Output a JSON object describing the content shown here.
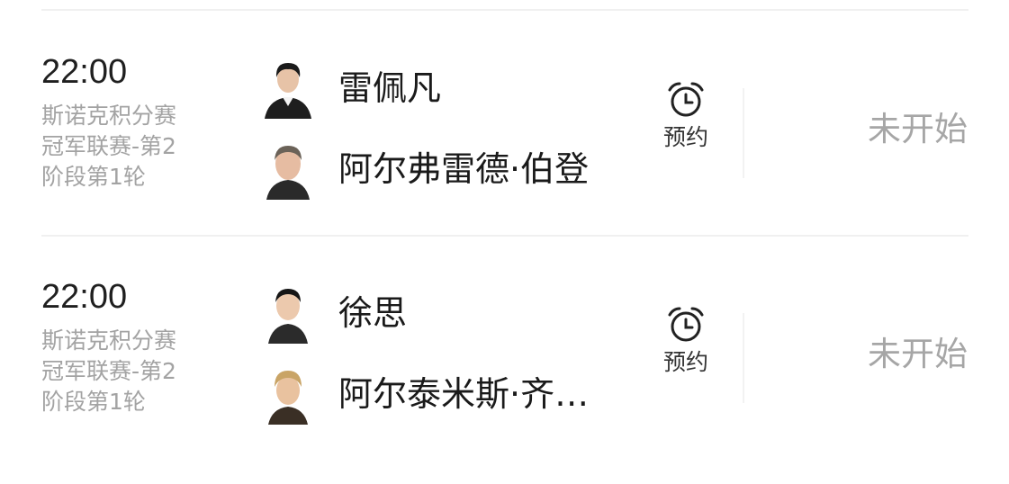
{
  "matches": [
    {
      "time": "22:00",
      "event_lines": [
        "斯诺克积分赛",
        "冠军联赛-第2",
        "阶段第1轮"
      ],
      "players": [
        {
          "name": "雷佩凡",
          "avatar": "player-photo"
        },
        {
          "name": "阿尔弗雷德·伯登",
          "avatar": "player-photo"
        }
      ],
      "reminder": {
        "label": "预约",
        "icon": "alarm-clock-icon"
      },
      "status": "未开始"
    },
    {
      "time": "22:00",
      "event_lines": [
        "斯诺克积分赛",
        "冠军联赛-第2",
        "阶段第1轮"
      ],
      "players": [
        {
          "name": "徐思",
          "avatar": "player-photo"
        },
        {
          "name": "阿尔泰米斯·齐…",
          "avatar": "player-photo"
        }
      ],
      "reminder": {
        "label": "预约",
        "icon": "alarm-clock-icon"
      },
      "status": "未开始"
    }
  ],
  "colors": {
    "primary_text": "#1a1a1a",
    "secondary_text": "#a3a3a3",
    "divider": "#f0f0f0",
    "status_text": "#a6a6a6"
  }
}
